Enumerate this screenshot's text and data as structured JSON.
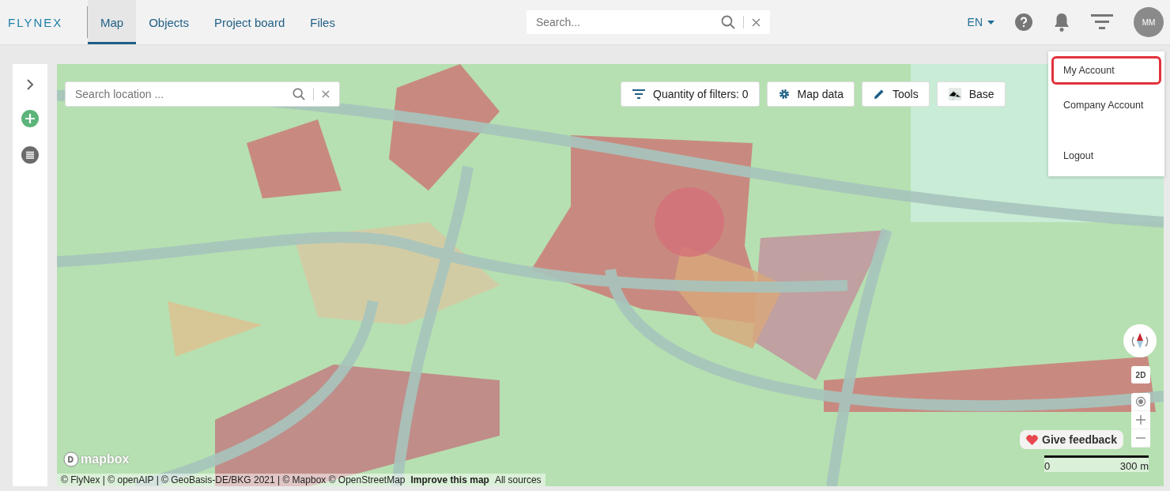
{
  "header": {
    "logo": "FLYNEX",
    "tabs": [
      {
        "label": "Map",
        "selected": true
      },
      {
        "label": "Objects",
        "selected": false
      },
      {
        "label": "Project board",
        "selected": false
      },
      {
        "label": "Files",
        "selected": false
      }
    ],
    "search": {
      "placeholder": "Search..."
    },
    "language": "EN",
    "avatar": "MM"
  },
  "account_menu": {
    "items": [
      {
        "label": "My Account",
        "selected": true
      },
      {
        "label": "Company Account",
        "selected": false
      },
      {
        "label": "Logout",
        "selected": false
      }
    ]
  },
  "map": {
    "search": {
      "placeholder": "Search location ..."
    },
    "toolbar": [
      {
        "kind": "filter",
        "label": "Quantity of filters: 0"
      },
      {
        "kind": "settings",
        "label": "Map data"
      },
      {
        "kind": "tools",
        "label": "Tools"
      },
      {
        "kind": "base",
        "label": "Base"
      }
    ],
    "view_toggle": "2D",
    "feedback": "Give feedback",
    "scale": {
      "start": "0",
      "end": "300 m"
    },
    "mapbox_logo": "mapbox",
    "attribution": {
      "text": "© FlyNex | © openAIP | © GeoBasis-DE/BKG 2021 | © Mapbox © OpenStreetMap",
      "improve_link": "Improve this map",
      "sources_link": "All sources"
    }
  }
}
